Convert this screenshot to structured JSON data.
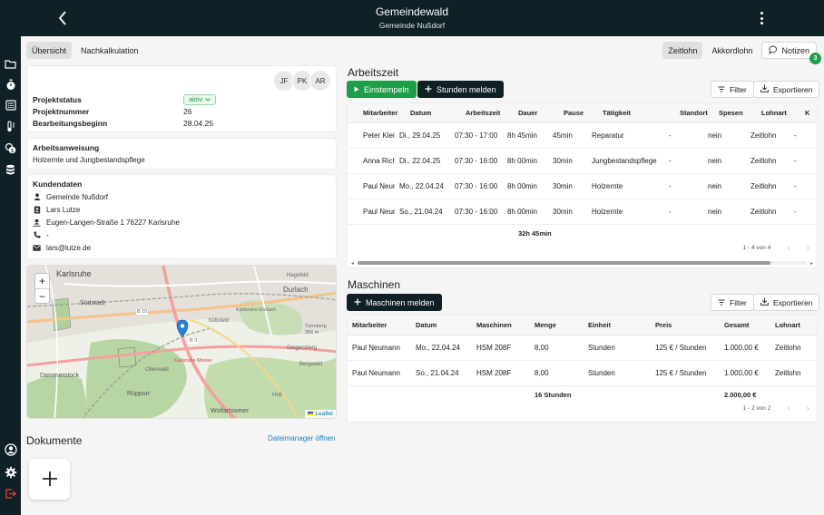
{
  "header": {
    "title": "Gemeindewald",
    "subtitle": "Gemeinde Nußdorf"
  },
  "sidebar": {
    "icons": [
      "folder-icon",
      "stopwatch-icon",
      "calculator-icon",
      "thermometer-icon",
      "money-icon",
      "database-icon"
    ],
    "bottom_icons": [
      "account-icon",
      "gear-icon",
      "logout-icon"
    ]
  },
  "tabs": {
    "left": [
      "Übersicht",
      "Nachkalkulation"
    ],
    "right": [
      "Zeitlohn",
      "Akkordlohn"
    ],
    "notes_label": "Notizen",
    "notes_count": "3"
  },
  "project": {
    "avatars": [
      "JF",
      "PK",
      "AR"
    ],
    "rows": [
      {
        "label": "Projektstatus",
        "value": "aktiv"
      },
      {
        "label": "Projektnummer",
        "value": "26"
      },
      {
        "label": "Bearbeitungsbeginn",
        "value": "28.04.25"
      }
    ]
  },
  "instruction": {
    "title": "Arbeitsanweisung",
    "text": "Holzernte und Jungbestandspflege"
  },
  "customer": {
    "title": "Kundendaten",
    "name": "Gemeinde Nußdorf",
    "contact": "Lars Lutze",
    "address": "Eugen-Langen-Straße 1 76227 Karlsruhe",
    "phone": "-",
    "email": "lars@lutze.de"
  },
  "map": {
    "labels": [
      "Karlsruhe",
      "Südstadt",
      "Durlach",
      "Dammerstock",
      "Rüppurr",
      "Wolfartsweier",
      "Killisfeld",
      "Geigersberg",
      "Turmberg 256 m",
      "Bergwald",
      "Oberwald",
      "Hub",
      "Karlsruhe-Durlach",
      "Karlsruhe Messe",
      "B 10",
      "B 3",
      "Hagsfeld"
    ],
    "zoom_in": "+",
    "zoom_out": "−",
    "attribution": "Leaflet"
  },
  "documents": {
    "title": "Dokumente",
    "link": "Dateimanager öffnen"
  },
  "arbeitszeit": {
    "title": "Arbeitszeit",
    "btn_start": "Einstempeln",
    "btn_report": "Stunden melden",
    "filter": "Filter",
    "export": "Exportieren",
    "columns": [
      "Mitarbeiter",
      "Datum",
      "Arbeitszeit",
      "Dauer",
      "Pause",
      "Tätigkeit",
      "Standort",
      "Spesen",
      "Lohnart",
      "K"
    ],
    "rows": [
      [
        "Peter Klein",
        "Di., 29.04.25",
        "07:30 - 17:00",
        "8h 45min",
        "45min",
        "Reparatur",
        "-",
        "nein",
        "Zeitlohn",
        "-"
      ],
      [
        "Anna Richter",
        "Di., 22.04.25",
        "07:30 - 16:00",
        "8h 00min",
        "30min",
        "Jungbestandspflege",
        "-",
        "nein",
        "Zeitlohn",
        "-"
      ],
      [
        "Paul Neumann",
        "Mo., 22.04.24",
        "07:30 - 16:00",
        "8h 00min",
        "30min",
        "Holzernte",
        "-",
        "nein",
        "Zeitlohn",
        "-"
      ],
      [
        "Paul Neumann",
        "So., 21.04.24",
        "07:30 - 16:00",
        "8h 00min",
        "30min",
        "Holzernte",
        "-",
        "nein",
        "Zeitlohn",
        "-"
      ]
    ],
    "total": "32h 45min",
    "pagination": "1 - 4 von 4"
  },
  "maschinen": {
    "title": "Maschinen",
    "btn_report": "Maschinen melden",
    "filter": "Filter",
    "export": "Exportieren",
    "columns": [
      "Mitarbeiter",
      "Datum",
      "Maschinen",
      "Menge",
      "Einheit",
      "Preis",
      "Gesamt",
      "Lohnart"
    ],
    "rows": [
      [
        "Paul Neumann",
        "Mo., 22.04.24",
        "HSM 208F",
        "8,00",
        "Stunden",
        "125 € / Stunden",
        "1.000,00 €",
        "Zeitlohn"
      ],
      [
        "Paul Neumann",
        "So., 21.04.24",
        "HSM 208F",
        "8,00",
        "Stunden",
        "125 € / Stunden",
        "1.000,00 €",
        "Zeitlohn"
      ]
    ],
    "total_menge": "16 Stunden",
    "total_gesamt": "2.000,00 €",
    "pagination": "1 - 2 von 2"
  },
  "colors": {
    "dark": "#0f2126",
    "green": "#1e9e4a",
    "link": "#1a7fc1"
  }
}
